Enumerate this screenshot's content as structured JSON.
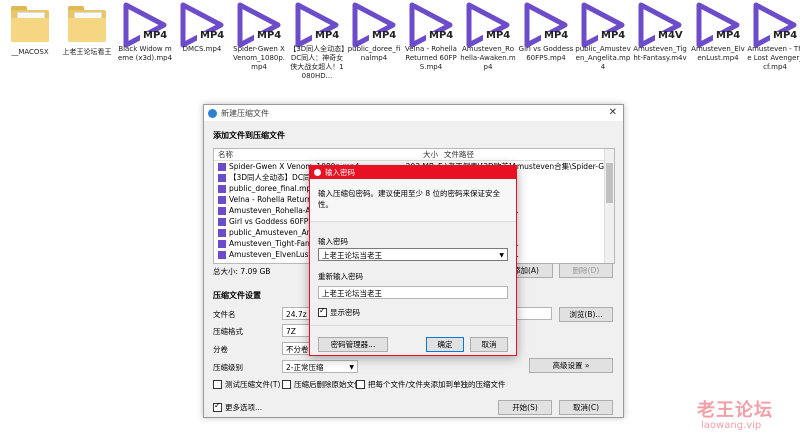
{
  "desktop_icons": [
    {
      "type": "folder",
      "label": "__MACOSX"
    },
    {
      "type": "folder",
      "label": "上老王论坛看王"
    },
    {
      "type": "mp4",
      "badge": "MP4",
      "label": "Black Widow meme (x3d).mp4"
    },
    {
      "type": "mp4",
      "badge": "MP4",
      "label": "DMCS.mp4"
    },
    {
      "type": "mp4",
      "badge": "MP4",
      "label": "Spider-Gwen X Venom_1080p.mp4"
    },
    {
      "type": "mp4",
      "badge": "MP4",
      "label": "【3D同人全动态】DC同人：神奇女侠大战女超人！1080HD..."
    },
    {
      "type": "mp4",
      "badge": "MP4",
      "label": "public_doree_finalmp4"
    },
    {
      "type": "mp4",
      "badge": "MP4",
      "label": "Velna - Rohella Returned 60FPS.mp4"
    },
    {
      "type": "mp4",
      "badge": "MP4",
      "label": "Amusteven_Rohella-Awaken.mp4"
    },
    {
      "type": "mp4",
      "badge": "MP4",
      "label": "Girl vs Goddess 60FPS.mp4"
    },
    {
      "type": "mp4",
      "badge": "MP4",
      "label": "public_Amusteven_Angelita.mp4"
    },
    {
      "type": "m4v",
      "badge": "M4V",
      "label": "Amusteven_Tight-Fantasy.m4v"
    },
    {
      "type": "mp4",
      "badge": "MP4",
      "label": "Amusteven_ElvenLust.mp4"
    },
    {
      "type": "mp4",
      "badge": "MP4",
      "label": "Amusteven - The Lost Avenger_cf.mp4"
    }
  ],
  "dialog": {
    "title": "新建压缩文件",
    "add_files_heading": "添加文件到压缩文件",
    "columns": {
      "name": "名称",
      "size": "大小",
      "path": "文件路径"
    },
    "files": [
      {
        "name": "Spider-Gwen X Venom_1080p.mp4",
        "size": "203 MB",
        "path": "E:\\老王倒卖\\[3D欧美]Amusteven合集\\Spider-Gw..."
      },
      {
        "name": "【3D同人全动态】DC同人：神...",
        "size": "",
        "path": "ven合集\\【3D同人..."
      },
      {
        "name": "public_doree_final.mp4",
        "size": "",
        "path": "ven合集\\public_dor..."
      },
      {
        "name": "Velna - Rohella Returned 60F...",
        "size": "",
        "path": "ven合集\\Velna - Ro..."
      },
      {
        "name": "Amusteven_Rohella-Awaken...",
        "size": "",
        "path": "ven合集\\Amusteven..."
      },
      {
        "name": "Girl vs Goddess 60FPS.mp4",
        "size": "",
        "path": "ven合集\\Girl vs Go..."
      },
      {
        "name": "public_Amusteven_Angelita.mp...",
        "size": "",
        "path": "ven合集\\public_Am..."
      },
      {
        "name": "Amusteven_Tight-Fantasy.m4...",
        "size": "",
        "path": "ven合集\\Amusteven..."
      },
      {
        "name": "Amusteven_ElvenLust.mp4",
        "size": "",
        "path": "ven合集\\Amusteven..."
      }
    ],
    "total_size": "总大小: 7.09 GB",
    "add_button": "添加(A)",
    "delete_button": "删除(D)",
    "settings_heading": "压缩文件设置",
    "filename_label": "文件名",
    "filename_value": "24.7z",
    "browse_button": "浏览(B)...",
    "format_label": "压缩格式",
    "format_value": "7Z",
    "volume_label": "分卷",
    "volume_value": "不分卷",
    "level_label": "压缩级别",
    "level_value": "2-正常压缩",
    "advanced_button": "高级设置 »",
    "chk_test": "测试压缩文件(T)",
    "chk_delete": "压缩后删除原始文件",
    "chk_each": "把每个文件/文件夹添加到单独的压缩文件",
    "more_options": "更多选项...",
    "start_button": "开始(S)",
    "cancel_button": "取消(C)"
  },
  "password_dialog": {
    "title": "输入密码",
    "hint": "输入压缩包密码。建议使用至少 8 位的密码来保证安全性。",
    "enter_label": "输入密码",
    "enter_value": "上老王论坛当老王",
    "reenter_label": "重新输入密码",
    "reenter_value": "上老王论坛当老王",
    "show_password": "显示密码",
    "manager_button": "密码管理器...",
    "ok_button": "确定",
    "cancel_button": "取消"
  },
  "watermark": {
    "line1": "老王论坛",
    "line2": "laowang.vip"
  },
  "colors": {
    "accent": "#e81123",
    "mp4_purple": "#6c4cc8"
  }
}
